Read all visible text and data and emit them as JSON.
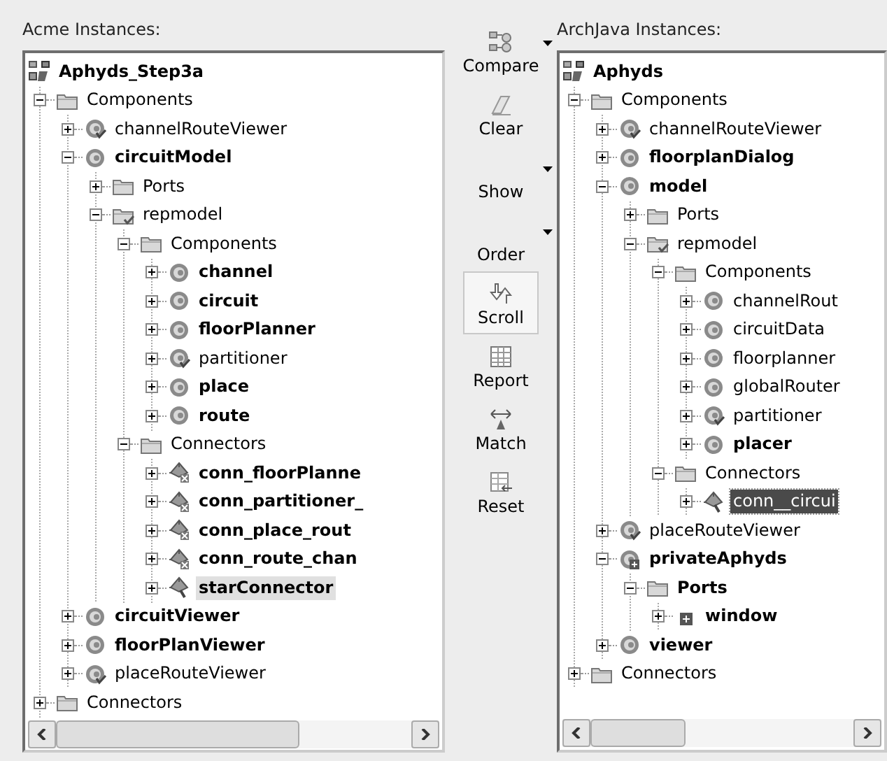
{
  "panels": [
    {
      "title": "Acme Instances:",
      "focused": false,
      "root": {
        "label": "Aphyds_Step3a",
        "kind": "root",
        "bold": true,
        "selected": false,
        "children": [
          {
            "label": "Components",
            "kind": "folder",
            "bold": false,
            "selected": false,
            "expanded": true,
            "children": [
              {
                "label": "channelRouteViewer",
                "kind": "comp-check",
                "bold": false,
                "selected": false,
                "expanded": false
              },
              {
                "label": "circuitModel",
                "kind": "comp",
                "bold": true,
                "selected": false,
                "expanded": true,
                "children": [
                  {
                    "label": "Ports",
                    "kind": "folder",
                    "bold": false,
                    "selected": false,
                    "expanded": false
                  },
                  {
                    "label": "repmodel",
                    "kind": "folder-check",
                    "bold": false,
                    "selected": false,
                    "expanded": true,
                    "children": [
                      {
                        "label": "Components",
                        "kind": "folder",
                        "bold": false,
                        "selected": false,
                        "expanded": true,
                        "children": [
                          {
                            "label": "channel",
                            "kind": "comp",
                            "bold": true,
                            "selected": false,
                            "expanded": false
                          },
                          {
                            "label": "circuit",
                            "kind": "comp",
                            "bold": true,
                            "selected": false,
                            "expanded": false
                          },
                          {
                            "label": "floorPlanner",
                            "kind": "comp",
                            "bold": true,
                            "selected": false,
                            "expanded": false
                          },
                          {
                            "label": "partitioner",
                            "kind": "comp-check",
                            "bold": false,
                            "selected": false,
                            "expanded": false
                          },
                          {
                            "label": "place",
                            "kind": "comp",
                            "bold": true,
                            "selected": false,
                            "expanded": false
                          },
                          {
                            "label": "route",
                            "kind": "comp",
                            "bold": true,
                            "selected": false,
                            "expanded": false
                          }
                        ]
                      },
                      {
                        "label": "Connectors",
                        "kind": "folder",
                        "bold": false,
                        "selected": false,
                        "expanded": true,
                        "children": [
                          {
                            "label": "conn_floorPlanne",
                            "kind": "connector-x",
                            "bold": true,
                            "selected": false,
                            "expanded": false
                          },
                          {
                            "label": "conn_partitioner_",
                            "kind": "connector-x",
                            "bold": true,
                            "selected": false,
                            "expanded": false
                          },
                          {
                            "label": "conn_place_rout",
                            "kind": "connector-x",
                            "bold": true,
                            "selected": false,
                            "expanded": false
                          },
                          {
                            "label": "conn_route_chan",
                            "kind": "connector-x",
                            "bold": true,
                            "selected": false,
                            "expanded": false
                          },
                          {
                            "label": "starConnector",
                            "kind": "connector",
                            "bold": true,
                            "selected": true,
                            "expanded": false
                          }
                        ]
                      }
                    ]
                  }
                ]
              },
              {
                "label": "circuitViewer",
                "kind": "comp",
                "bold": true,
                "selected": false,
                "expanded": false
              },
              {
                "label": "floorPlanViewer",
                "kind": "comp",
                "bold": true,
                "selected": false,
                "expanded": false
              },
              {
                "label": "placeRouteViewer",
                "kind": "comp-check",
                "bold": false,
                "selected": false,
                "expanded": false
              }
            ]
          },
          {
            "label": "Connectors",
            "kind": "folder",
            "bold": false,
            "selected": false,
            "expanded": false
          }
        ]
      }
    },
    {
      "title": "ArchJava Instances:",
      "focused": true,
      "root": {
        "label": "Aphyds",
        "kind": "root",
        "bold": true,
        "selected": false,
        "children": [
          {
            "label": "Components",
            "kind": "folder",
            "bold": false,
            "selected": false,
            "expanded": true,
            "children": [
              {
                "label": "channelRouteViewer",
                "kind": "comp-check",
                "bold": false,
                "selected": false,
                "expanded": false
              },
              {
                "label": "floorplanDialog",
                "kind": "comp",
                "bold": true,
                "selected": false,
                "expanded": false
              },
              {
                "label": "model",
                "kind": "comp",
                "bold": true,
                "selected": false,
                "expanded": true,
                "children": [
                  {
                    "label": "Ports",
                    "kind": "folder",
                    "bold": false,
                    "selected": false,
                    "expanded": false
                  },
                  {
                    "label": "repmodel",
                    "kind": "folder-check",
                    "bold": false,
                    "selected": false,
                    "expanded": true,
                    "children": [
                      {
                        "label": "Components",
                        "kind": "folder",
                        "bold": false,
                        "selected": false,
                        "expanded": true,
                        "children": [
                          {
                            "label": "channelRout",
                            "kind": "comp",
                            "bold": false,
                            "selected": false,
                            "expanded": false
                          },
                          {
                            "label": "circuitData",
                            "kind": "comp",
                            "bold": false,
                            "selected": false,
                            "expanded": false
                          },
                          {
                            "label": "floorplanner",
                            "kind": "comp",
                            "bold": false,
                            "selected": false,
                            "expanded": false
                          },
                          {
                            "label": "globalRouter",
                            "kind": "comp",
                            "bold": false,
                            "selected": false,
                            "expanded": false
                          },
                          {
                            "label": "partitioner",
                            "kind": "comp-check",
                            "bold": false,
                            "selected": false,
                            "expanded": false
                          },
                          {
                            "label": "placer",
                            "kind": "comp",
                            "bold": true,
                            "selected": false,
                            "expanded": false
                          }
                        ]
                      },
                      {
                        "label": "Connectors",
                        "kind": "folder",
                        "bold": false,
                        "selected": false,
                        "expanded": true,
                        "children": [
                          {
                            "label": "conn__circui",
                            "kind": "connector",
                            "bold": false,
                            "selected": true,
                            "expanded": false
                          }
                        ]
                      }
                    ]
                  }
                ]
              },
              {
                "label": "placeRouteViewer",
                "kind": "comp-check",
                "bold": false,
                "selected": false,
                "expanded": false
              },
              {
                "label": "privateAphyds",
                "kind": "comp-port",
                "bold": true,
                "selected": false,
                "expanded": true,
                "children": [
                  {
                    "label": "Ports",
                    "kind": "folder",
                    "bold": true,
                    "selected": false,
                    "expanded": true,
                    "children": [
                      {
                        "label": "window",
                        "kind": "port",
                        "bold": true,
                        "selected": false,
                        "expanded": false
                      }
                    ]
                  }
                ]
              },
              {
                "label": "viewer",
                "kind": "comp",
                "bold": true,
                "selected": false,
                "expanded": false
              }
            ]
          },
          {
            "label": "Connectors",
            "kind": "folder",
            "bold": false,
            "selected": false,
            "expanded": false
          }
        ]
      }
    }
  ],
  "toolbar": [
    {
      "label": "Compare",
      "menu": true,
      "selected": false
    },
    {
      "label": "Clear",
      "menu": false,
      "selected": false
    },
    {
      "label": "Show",
      "menu": true,
      "selected": false
    },
    {
      "label": "Order",
      "menu": true,
      "selected": false
    },
    {
      "label": "Scroll",
      "menu": false,
      "selected": true
    },
    {
      "label": "Report",
      "menu": false,
      "selected": false
    },
    {
      "label": "Match",
      "menu": false,
      "selected": false
    },
    {
      "label": "Reset",
      "menu": false,
      "selected": false
    }
  ]
}
